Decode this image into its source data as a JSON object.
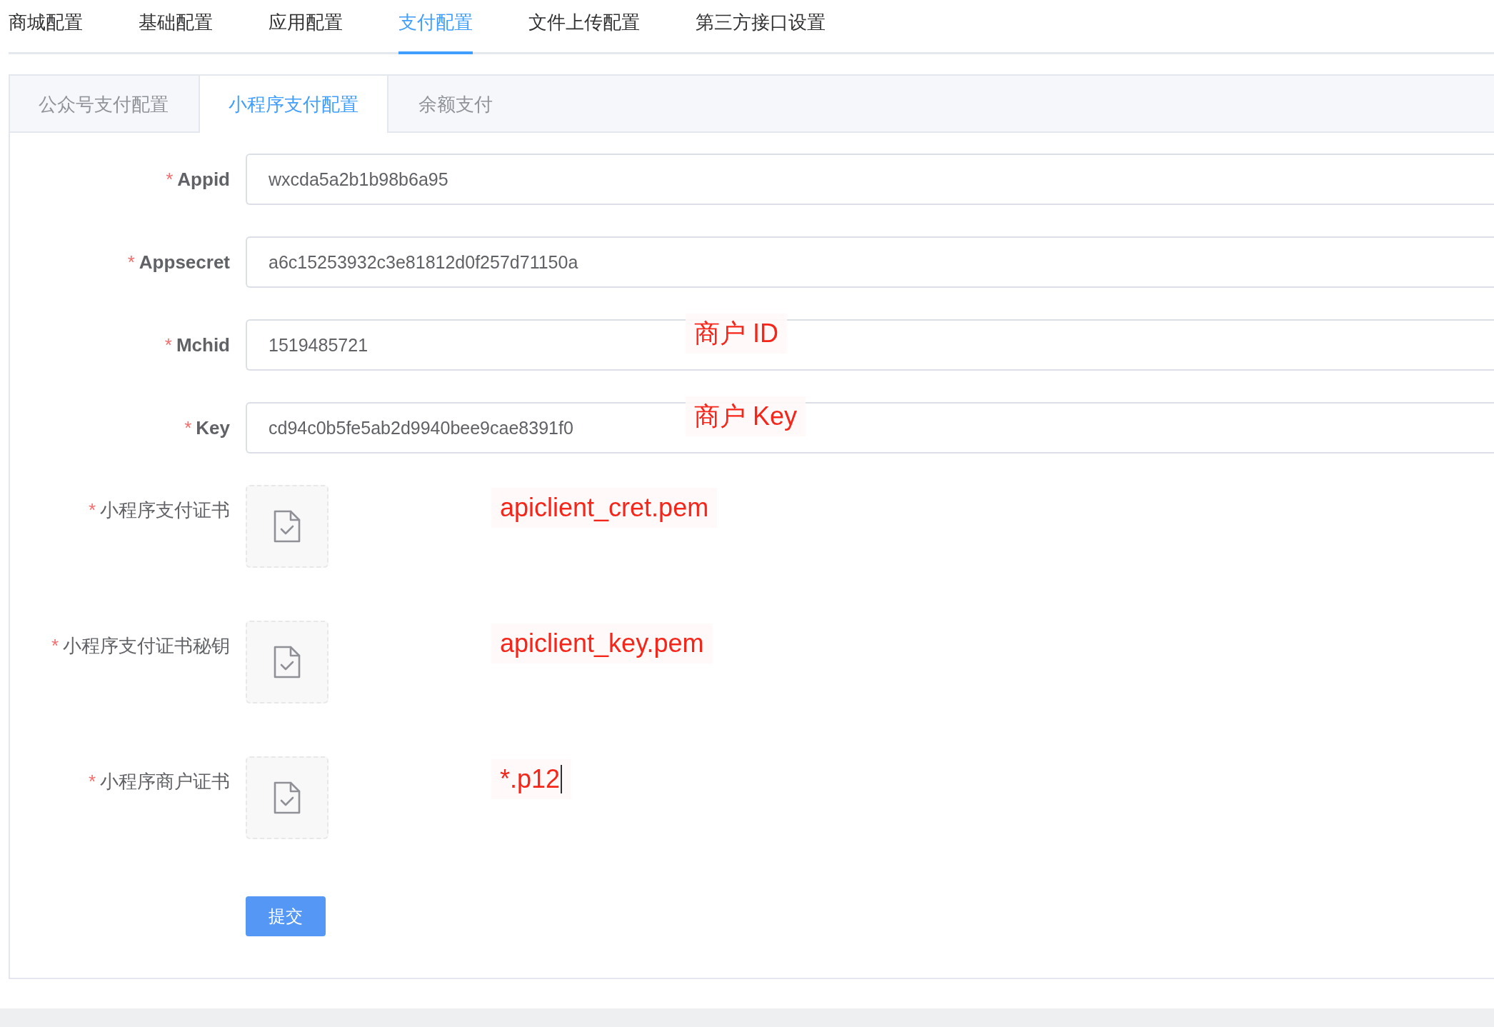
{
  "main_tabs": [
    {
      "label": "商城配置",
      "selected": false
    },
    {
      "label": "基础配置",
      "selected": false
    },
    {
      "label": "应用配置",
      "selected": false
    },
    {
      "label": "支付配置",
      "selected": true
    },
    {
      "label": "文件上传配置",
      "selected": false
    },
    {
      "label": "第三方接口设置",
      "selected": false
    }
  ],
  "sub_tabs": [
    {
      "label": "公众号支付配置",
      "selected": false
    },
    {
      "label": "小程序支付配置",
      "selected": true
    },
    {
      "label": "余额支付",
      "selected": false
    }
  ],
  "form": {
    "fields": [
      {
        "kind": "text",
        "label": "Appid",
        "required_mark": "*",
        "value": "wxcda5a2b1b98b6a95"
      },
      {
        "kind": "text",
        "label": "Appsecret",
        "required_mark": "*",
        "value": "a6c15253932c3e81812d0f257d71150a"
      },
      {
        "kind": "text",
        "label": "Mchid",
        "required_mark": "*",
        "value": "1519485721",
        "annotation": {
          "text": "商户 ID",
          "caret": false
        }
      },
      {
        "kind": "text",
        "label": "Key",
        "required_mark": "*",
        "value": "cd94c0b5fe5ab2d9940bee9cae8391f0",
        "annotation": {
          "text": "商户 Key",
          "caret": false
        }
      },
      {
        "kind": "upload",
        "label": "小程序支付证书",
        "required_mark": "*",
        "annotation": {
          "text": "apiclient_cret.pem",
          "caret": false
        }
      },
      {
        "kind": "upload",
        "label": "小程序支付证书秘钥",
        "required_mark": "*",
        "annotation": {
          "text": "apiclient_key.pem",
          "caret": false
        }
      },
      {
        "kind": "upload",
        "label": "小程序商户证书",
        "required_mark": "*",
        "annotation": {
          "text": "*.p12",
          "caret": true
        }
      }
    ],
    "submit": "提交"
  }
}
